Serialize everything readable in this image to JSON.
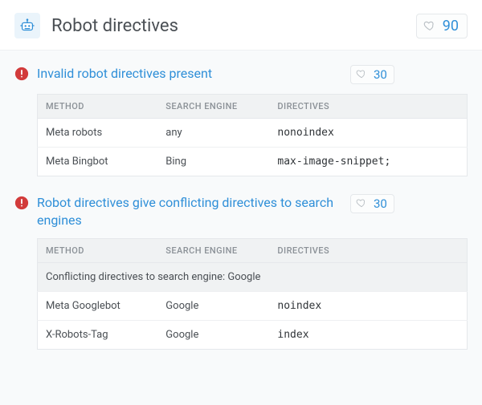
{
  "header": {
    "title": "Robot directives",
    "score": "90"
  },
  "table_headers": {
    "method": "METHOD",
    "engine": "SEARCH ENGINE",
    "directives": "DIRECTIVES"
  },
  "issues": [
    {
      "id": "invalid",
      "title": "Invalid robot directives present",
      "score": "30",
      "group_row": null,
      "rows": [
        {
          "method": "Meta robots",
          "engine": "any",
          "directives": "nonoindex"
        },
        {
          "method": "Meta Bingbot",
          "engine": "Bing",
          "directives": "max-image-snippet;"
        }
      ]
    },
    {
      "id": "conflicting",
      "title": "Robot directives give conflicting directives to search engines",
      "score": "30",
      "group_row": "Conflicting directives to search engine: Google",
      "rows": [
        {
          "method": "Meta Googlebot",
          "engine": "Google",
          "directives": "noindex"
        },
        {
          "method": "X-Robots-Tag",
          "engine": "Google",
          "directives": "index"
        }
      ]
    }
  ]
}
